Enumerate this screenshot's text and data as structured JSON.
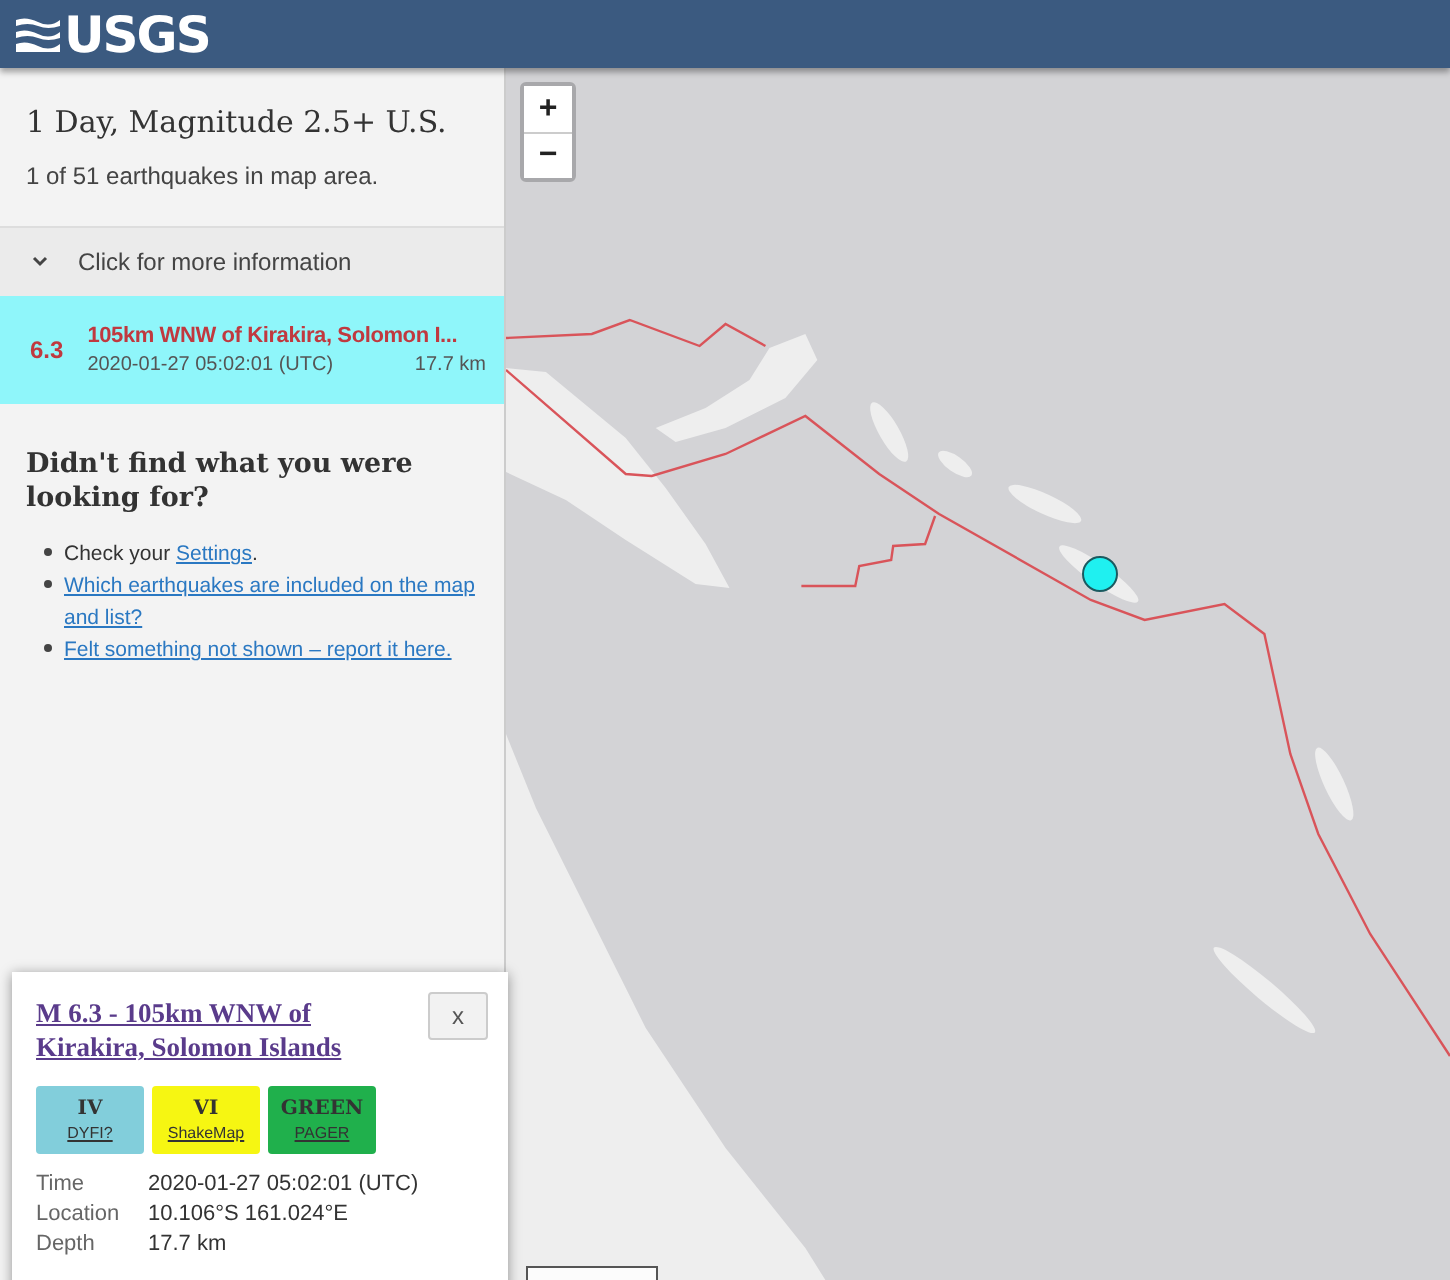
{
  "header": {
    "logo": "USGS"
  },
  "list_panel": {
    "title": "1 Day, Magnitude 2.5+ U.S.",
    "count": "1 of 51 earthquakes in map area.",
    "info_toggle": {
      "label": "Click for more information",
      "expanded": false
    },
    "events": [
      {
        "magnitude": "6.3",
        "place": "105km WNW of Kirakira, Solomon I...",
        "time": "2020-01-27 05:02:01 (UTC)",
        "depth": "17.7 km",
        "selected": true
      }
    ],
    "help": {
      "title": "Didn't find what you were looking for?",
      "items": [
        {
          "kind": "text_link",
          "before": "Check your ",
          "link": "Settings",
          "after": "."
        },
        {
          "kind": "link",
          "link": "Which earthquakes are included on the map and list?"
        },
        {
          "kind": "link",
          "link": "Felt something not shown – report it here."
        }
      ]
    }
  },
  "map": {
    "zoom_in": "+",
    "zoom_out": "−"
  },
  "popup": {
    "title": "M 6.3 - 105km WNW of Kirakira, Solomon Islands",
    "close": "x",
    "badges": [
      {
        "value": "IV",
        "label": "DYFI?",
        "color": "#82cedb"
      },
      {
        "value": "VI",
        "label": "ShakeMap",
        "color": "#f6f612"
      },
      {
        "value": "GREEN",
        "label": "PAGER",
        "color": "#20b04c"
      }
    ],
    "details": [
      {
        "label": "Time",
        "value": "2020-01-27 05:02:01 (UTC)"
      },
      {
        "label": "Location",
        "value": "10.106°S 161.024°E"
      },
      {
        "label": "Depth",
        "value": "17.7 km"
      }
    ]
  }
}
